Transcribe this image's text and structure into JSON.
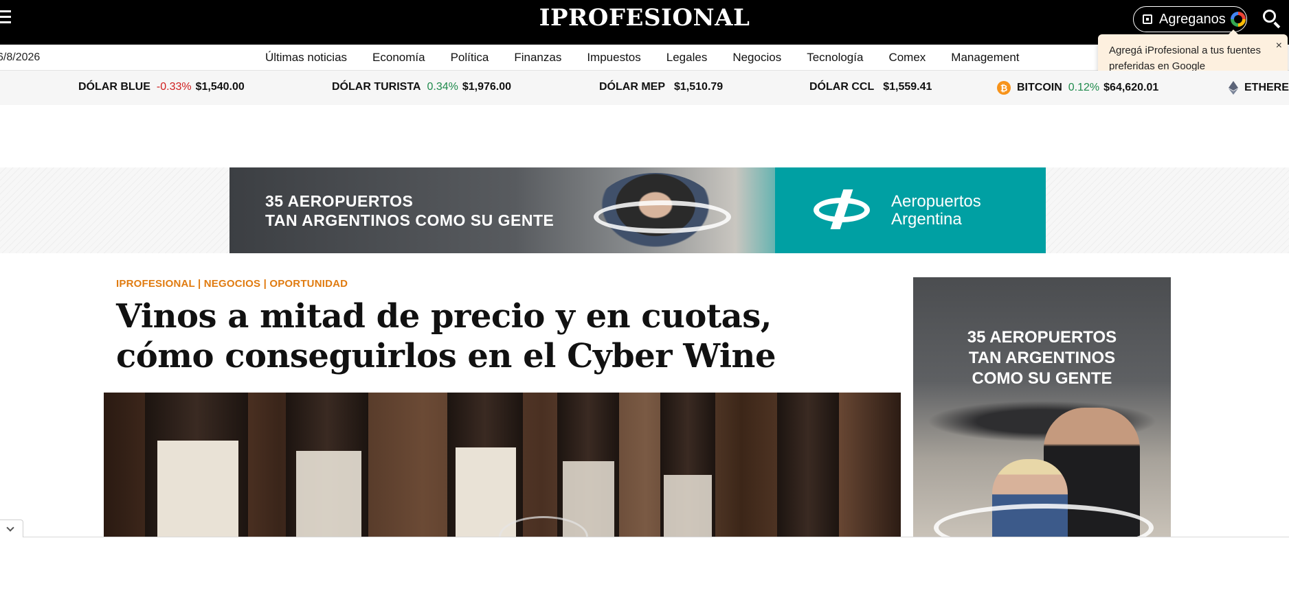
{
  "header": {
    "logo_main": "IPROFESIONAL",
    "add_button_label": "Agreganos",
    "tooltip_text": "Agregá iProfesional a tus fuentes preferidas en Google",
    "tooltip_close": "×",
    "icons": [
      "menu-icon",
      "bookmark-icon",
      "google-icon",
      "search-icon"
    ]
  },
  "nav": {
    "date": "6/8/2026",
    "items": [
      "Últimas noticias",
      "Economía",
      "Política",
      "Finanzas",
      "Impuestos",
      "Legales",
      "Negocios",
      "Tecnología",
      "Comex",
      "Management"
    ]
  },
  "ticker": [
    {
      "name": "DÓLAR BLUE",
      "change": "-0.33%",
      "value": "$1,540.00",
      "trend": "down"
    },
    {
      "name": "DÓLAR TURISTA",
      "change": "0.34%",
      "value": "$1,976.00",
      "trend": "up"
    },
    {
      "name": "DÓLAR MEP",
      "change": "",
      "value": "$1,510.79",
      "trend": "none"
    },
    {
      "name": "DÓLAR CCL",
      "change": "",
      "value": "$1,559.41",
      "trend": "none"
    },
    {
      "name": "BITCOIN",
      "change": "0.12%",
      "value": "$64,620.01",
      "trend": "up",
      "icon": "bitcoin-icon"
    },
    {
      "name": "ETHERE",
      "change": "",
      "value": "",
      "trend": "none",
      "icon": "ethereum-icon"
    }
  ],
  "top_ad": {
    "line1": "35 AEROPUERTOS",
    "line2": "TAN ARGENTINOS COMO SU GENTE",
    "brand_line1": "Aeropuertos",
    "brand_line2": "Argentina"
  },
  "article": {
    "kicker": "IPROFESIONAL | NEGOCIOS | OPORTUNIDAD",
    "headline": "Vinos a mitad de precio y en cuotas, cómo conseguirlos en el Cyber Wine"
  },
  "side_ad": {
    "line1": "35 AEROPUERTOS",
    "line2": "TAN ARGENTINOS",
    "line3": "COMO SU GENTE"
  },
  "colors": {
    "topbar": "#000000",
    "kicker": "#e07b10",
    "negative": "#d01e1e",
    "positive": "#1f8a4c",
    "teal": "#00a0a3",
    "tooltip_bg": "#fdf0df"
  }
}
